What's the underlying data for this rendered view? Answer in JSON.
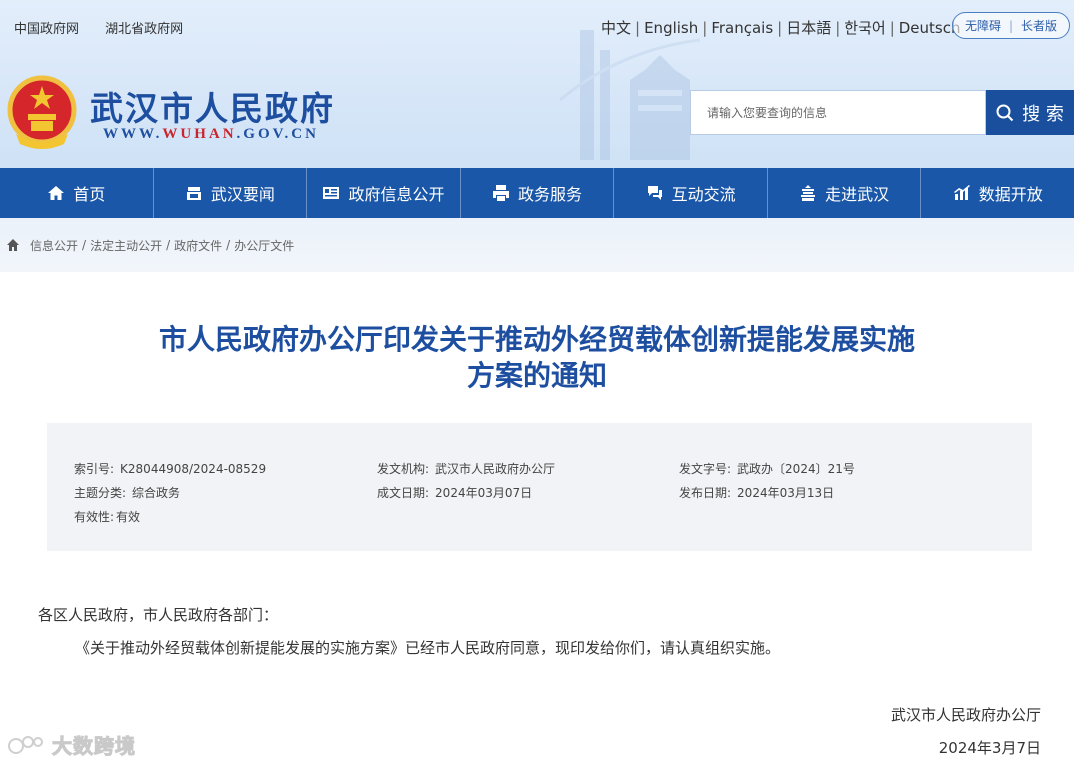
{
  "header": {
    "top_links": [
      "中国政府网",
      "湖北省政府网"
    ],
    "languages": [
      "中文",
      "English",
      "Français",
      "日本語",
      "한국어",
      "Deutsch"
    ],
    "accessibility": [
      "无障碍",
      "长者版"
    ],
    "site_name": "武汉市人民政府",
    "site_url_prefix": "WWW.",
    "site_url_highlight": "WUHAN",
    "site_url_suffix": ".GOV.CN",
    "search_placeholder": "请输入您要查询的信息",
    "search_button": "搜 索"
  },
  "nav": [
    {
      "label": "首页",
      "icon": "home-icon"
    },
    {
      "label": "武汉要闻",
      "icon": "news-icon"
    },
    {
      "label": "政府信息公开",
      "icon": "info-card-icon"
    },
    {
      "label": "政务服务",
      "icon": "printer-icon"
    },
    {
      "label": "互动交流",
      "icon": "chat-icon"
    },
    {
      "label": "走进武汉",
      "icon": "building-icon"
    },
    {
      "label": "数据开放",
      "icon": "chart-icon"
    }
  ],
  "breadcrumb": [
    "信息公开",
    "法定主动公开",
    "政府文件",
    "办公厅文件"
  ],
  "article": {
    "title_line1": "市人民政府办公厅印发关于推动外经贸载体创新提能发展实施",
    "title_line2": "方案的通知",
    "meta": {
      "index_no_label": "索引号:",
      "index_no": "K28044908/2024-08529",
      "issuer_label": "发文机构:",
      "issuer": "武汉市人民政府办公厅",
      "doc_no_label": "发文字号:",
      "doc_no": "武政办〔2024〕21号",
      "topic_label": "主题分类:",
      "topic": "综合政务",
      "created_label": "成文日期:",
      "created": "2024年03月07日",
      "published_label": "发布日期:",
      "published": "2024年03月13日",
      "validity_label": "有效性:",
      "validity": "有效"
    },
    "salutation": "各区人民政府，市人民政府各部门：",
    "paragraph": "《关于推动外经贸载体创新提能发展的实施方案》已经市人民政府同意，现印发给你们，请认真组织实施。",
    "sign_org": "武汉市人民政府办公厅",
    "sign_date": "2024年3月7日"
  },
  "watermark": "大数跨境",
  "colors": {
    "primary": "#1a57a8",
    "title": "#1d4ea0",
    "accent_red": "#c9252c"
  }
}
